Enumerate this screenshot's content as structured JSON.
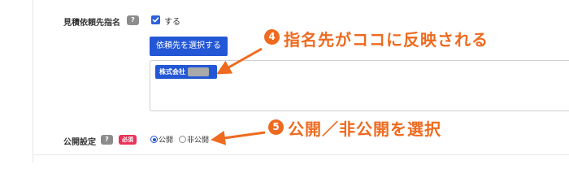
{
  "form": {
    "recipient_label": "見積依頼先指名",
    "help_mark": "?",
    "recipient_checkbox_label": "する",
    "select_button_label": "依頼先を選択する",
    "selected_chip_text": "株式会社",
    "publish_label": "公開設定",
    "required_badge": "必須",
    "publish_options": [
      "公開",
      "非公開"
    ],
    "publish_selected": "公開"
  },
  "callouts": [
    {
      "number": "4",
      "text": "指名先がココに反映される"
    },
    {
      "number": "5",
      "text": "公開／非公開を選択"
    }
  ],
  "colors": {
    "primary": "#2457d6",
    "callout": "#ee6a1f",
    "required": "#e8335a",
    "help": "#8c8c8c"
  }
}
